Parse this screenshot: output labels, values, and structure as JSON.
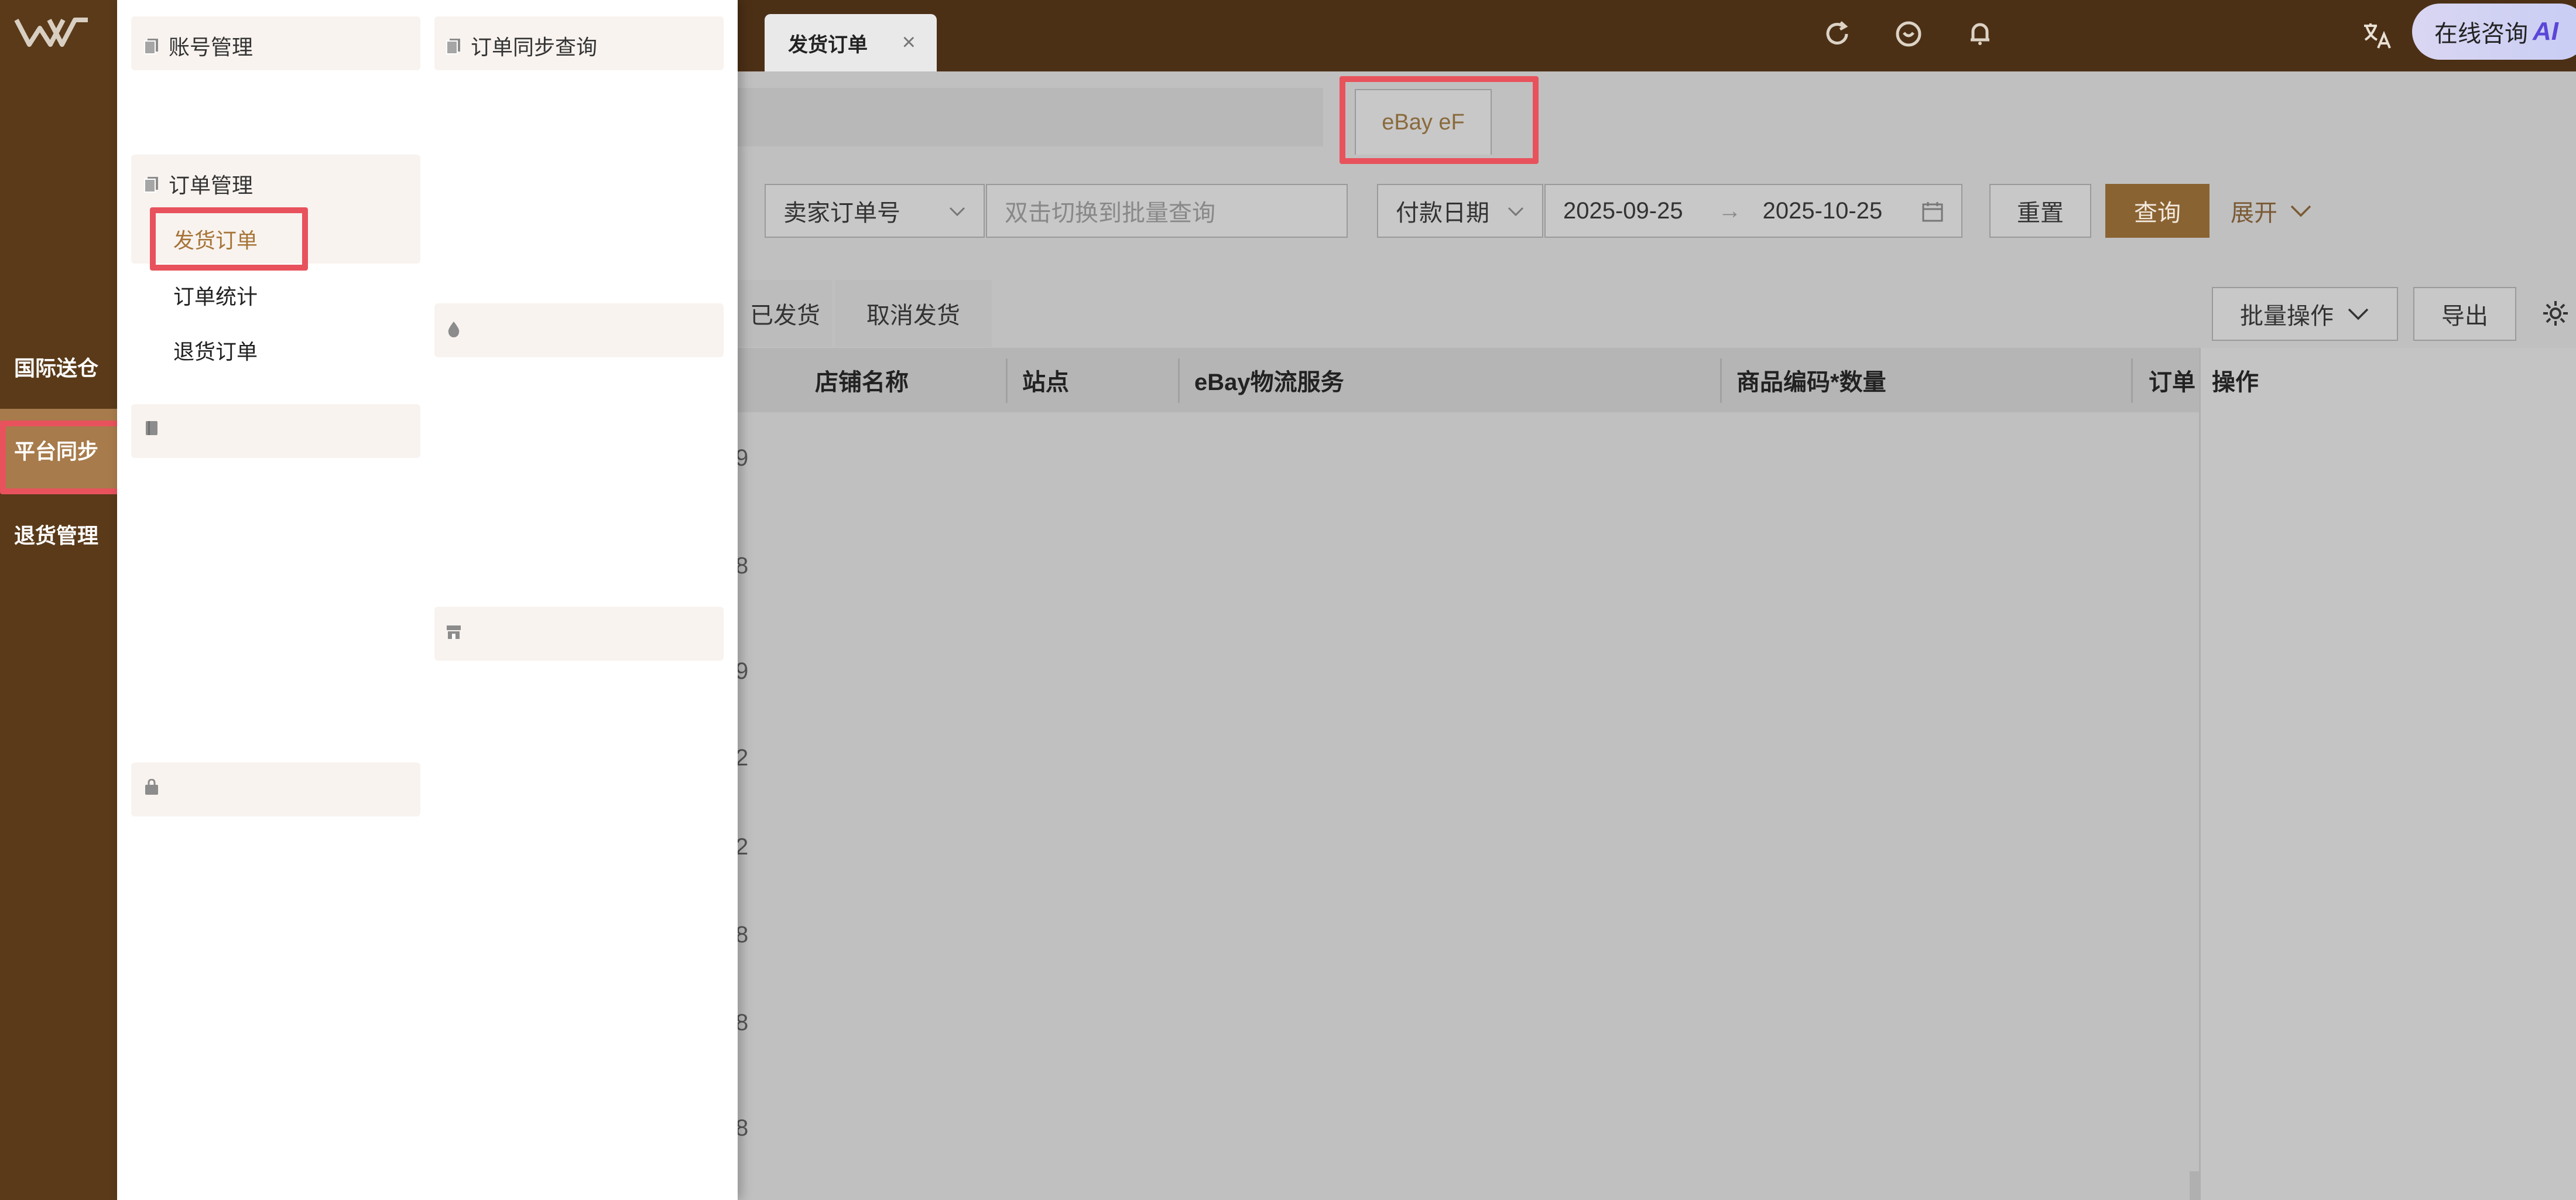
{
  "rail": {
    "items": [
      {
        "label": "国际送仓",
        "active": false
      },
      {
        "label": "平台同步",
        "active": true
      },
      {
        "label": "退货管理",
        "active": false
      }
    ]
  },
  "topbar": {
    "active_tab": "发货订单",
    "close_glyph": "×",
    "icons": [
      "refresh-icon",
      "smile-icon",
      "bell-icon",
      "translate-icon"
    ],
    "ai_pill": {
      "label": "在线咨询",
      "ai": "AI"
    }
  },
  "menu": {
    "col1": {
      "groups": [
        {
          "title": "账号管理",
          "icon": "doc-stack-icon",
          "items": []
        },
        {
          "title": "订单管理",
          "icon": "doc-stack-icon",
          "items": [
            {
              "label": "发货订单",
              "active": true
            },
            {
              "label": "订单统计",
              "active": false
            },
            {
              "label": "退货订单",
              "active": false
            }
          ]
        },
        {
          "title": "",
          "icon": "book-icon",
          "items": []
        },
        {
          "title": "",
          "icon": "bag-icon",
          "items": []
        }
      ]
    },
    "col2": {
      "groups": [
        {
          "title": "订单同步查询",
          "icon": "doc-stack-icon"
        },
        {
          "title": "",
          "icon": "drop-icon"
        },
        {
          "title": "",
          "icon": "store-icon"
        }
      ]
    }
  },
  "main": {
    "platform_tab": "eBay eF",
    "search": {
      "field_select": "卖家订单号",
      "query_placeholder": "双击切换到批量查询",
      "date_type": "付款日期",
      "date_start": "2025-09-25",
      "date_arrow": "→",
      "date_end": "2025-10-25",
      "reset": "重置",
      "query": "查询",
      "expand": "展开"
    },
    "status_tabs": [
      "已发货",
      "取消发货"
    ],
    "batch_button": "批量操作",
    "export_button": "导出",
    "columns": [
      "店铺名称",
      "站点",
      "eBay物流服务",
      "商品编码*数量",
      "订单",
      "操作"
    ],
    "row_marks": [
      "9",
      "8",
      "9",
      "2",
      "2",
      "8",
      "8",
      "8"
    ]
  },
  "colors": {
    "rail_bg": "#5a3a19",
    "topbar_bg": "#4c3016",
    "accent": "#8a6332",
    "highlight": "#e8525c",
    "active_link": "#a77438"
  }
}
